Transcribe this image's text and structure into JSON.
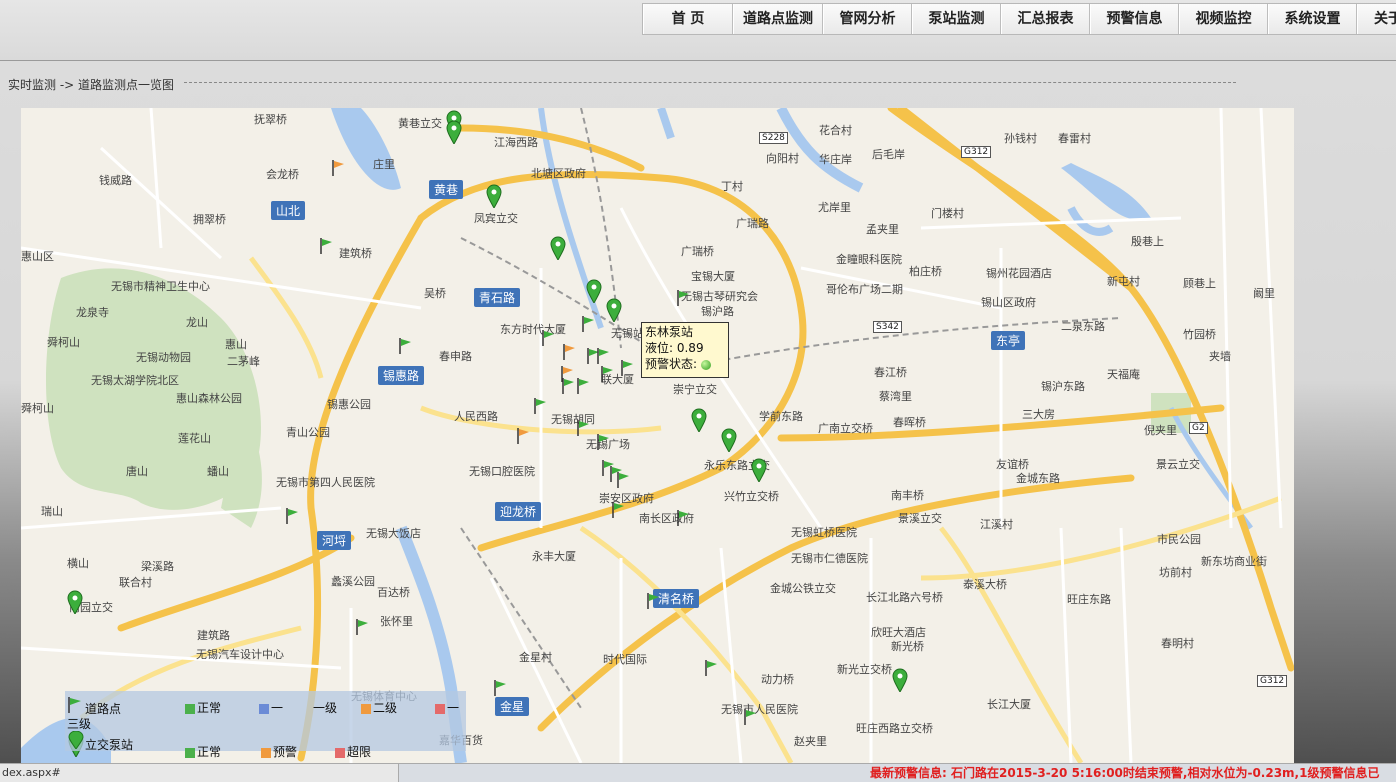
{
  "nav": [
    "首 页",
    "道路点监测",
    "管网分析",
    "泵站监测",
    "汇总报表",
    "预警信息",
    "视频监控",
    "系统设置",
    "关于"
  ],
  "breadcrumb": "实时监测 -> 道路监测点一览图",
  "tooltip": {
    "name": "东林泵站",
    "level": "液位: 0.89",
    "status": "预警状态:"
  },
  "map_labels": [
    {
      "t": "抚翠桥"
    },
    {
      "t": "黄巷立交"
    },
    {
      "t": "江海西路"
    },
    {
      "t": "花合村"
    },
    {
      "t": "孙钱村"
    },
    {
      "t": "春雷村"
    },
    {
      "t": "会龙桥"
    },
    {
      "t": "庄里"
    },
    {
      "t": "北塘区政府"
    },
    {
      "t": "丁村"
    },
    {
      "t": "向阳村"
    },
    {
      "t": "华庄岸"
    },
    {
      "t": "后毛岸"
    },
    {
      "t": "钱威路"
    },
    {
      "t": "凤宾立交"
    },
    {
      "t": "广瑞路"
    },
    {
      "t": "尤岸里"
    },
    {
      "t": "门楼村"
    },
    {
      "t": "孟夹里"
    },
    {
      "t": "殷巷上"
    },
    {
      "t": "拥翠桥"
    },
    {
      "t": "建筑桥"
    },
    {
      "t": "广瑞桥"
    },
    {
      "t": "金瞳眼科医院"
    },
    {
      "t": "柏庄桥"
    },
    {
      "t": "锡州花园酒店"
    },
    {
      "t": "惠山区"
    },
    {
      "t": "无锡市精神卫生中心"
    },
    {
      "t": "吴桥"
    },
    {
      "t": "宝锡大厦"
    },
    {
      "t": "无锡古琴研究会"
    },
    {
      "t": "哥伦布广场二期"
    },
    {
      "t": "锡山区政府"
    },
    {
      "t": "新屯村"
    },
    {
      "t": "顾巷上"
    },
    {
      "t": "阚里"
    },
    {
      "t": "龙泉寺"
    },
    {
      "t": "龙山"
    },
    {
      "t": "东方时代大厦"
    },
    {
      "t": "无锡站"
    },
    {
      "t": "锡沪路"
    },
    {
      "t": "二泉东路"
    },
    {
      "t": "竹园桥"
    },
    {
      "t": "舜柯山"
    },
    {
      "t": "惠山"
    },
    {
      "t": "无锡动物园"
    },
    {
      "t": "二茅峰"
    },
    {
      "t": "春申路"
    },
    {
      "t": "联大厦"
    },
    {
      "t": "春江桥"
    },
    {
      "t": "天福庵"
    },
    {
      "t": "夹墙"
    },
    {
      "t": "无锡太湖学院北区"
    },
    {
      "t": "惠山森林公园"
    },
    {
      "t": "锡惠公园"
    },
    {
      "t": "人民西路"
    },
    {
      "t": "无锡胡同"
    },
    {
      "t": "崇宁立交"
    },
    {
      "t": "学前东路"
    },
    {
      "t": "蔡湾里"
    },
    {
      "t": "锡沪东路"
    },
    {
      "t": "三大房"
    },
    {
      "t": "舜柯山"
    },
    {
      "t": "青山公园"
    },
    {
      "t": "无锡广场"
    },
    {
      "t": "广南立交桥"
    },
    {
      "t": "春晖桥"
    },
    {
      "t": "倪夹里"
    },
    {
      "t": "莲花山"
    },
    {
      "t": "无锡口腔医院"
    },
    {
      "t": "永乐东路立交"
    },
    {
      "t": "友谊桥"
    },
    {
      "t": "景云立交"
    },
    {
      "t": "唐山"
    },
    {
      "t": "蟠山"
    },
    {
      "t": "无锡市第四人民医院"
    },
    {
      "t": "崇安区政府"
    },
    {
      "t": "兴竹立交桥"
    },
    {
      "t": "南丰桥"
    },
    {
      "t": "金城东路"
    },
    {
      "t": "瑞山"
    },
    {
      "t": "南长区政府"
    },
    {
      "t": "无锡虹桥医院"
    },
    {
      "t": "景溪立交"
    },
    {
      "t": "江溪村"
    },
    {
      "t": "市民公园"
    },
    {
      "t": "无锡大饭店"
    },
    {
      "t": "永丰大厦"
    },
    {
      "t": "无锡市仁德医院"
    },
    {
      "t": "新东坊商业街"
    },
    {
      "t": "横山"
    },
    {
      "t": "梁溪路"
    },
    {
      "t": "蠡溪公园"
    },
    {
      "t": "坊前村"
    },
    {
      "t": "联合村"
    },
    {
      "t": "百达桥"
    },
    {
      "t": "金城公铁立交"
    },
    {
      "t": "泰溪大桥"
    },
    {
      "t": "南园立交"
    },
    {
      "t": "张怀里"
    },
    {
      "t": "长江北路六号桥"
    },
    {
      "t": "旺庄东路"
    },
    {
      "t": "建筑路"
    },
    {
      "t": "无锡汽车设计中心"
    },
    {
      "t": "金星村"
    },
    {
      "t": "时代国际"
    },
    {
      "t": "欣旺大酒店"
    },
    {
      "t": "新光桥"
    },
    {
      "t": "春明村"
    },
    {
      "t": "新光立交桥"
    },
    {
      "t": "动力桥"
    },
    {
      "t": "无锡体育中心"
    },
    {
      "t": "长江大厦"
    },
    {
      "t": "无锡市人民医院"
    },
    {
      "t": "旺庄西路立交桥"
    },
    {
      "t": "赵夹里"
    },
    {
      "t": "嘉华百货"
    }
  ],
  "area_badges": [
    "山北",
    "黄巷",
    "青石路",
    "锡惠路",
    "东亭",
    "迎龙桥",
    "河埒",
    "清名桥",
    "金星"
  ],
  "highways": [
    "S228",
    "G312",
    "S342",
    "G2",
    "G312"
  ],
  "legend": {
    "row1": [
      "道路点",
      "正常",
      "一",
      "一级",
      "二级",
      "一"
    ],
    "row1_wrap": "三级",
    "row2": [
      "立交泵站",
      "正常",
      "预警",
      "超限"
    ],
    "colors": {
      "normal": "#4bb04b",
      "level1": "#6b8bd6",
      "level2": "#f09a3e",
      "level3": "#e46a6a"
    }
  },
  "status": {
    "url": "dex.aspx#",
    "warning": "最新预警信息:  石门路在2015-3-20 5:16:00时结束预警,相对水位为-0.23m,1级预警信息已"
  }
}
